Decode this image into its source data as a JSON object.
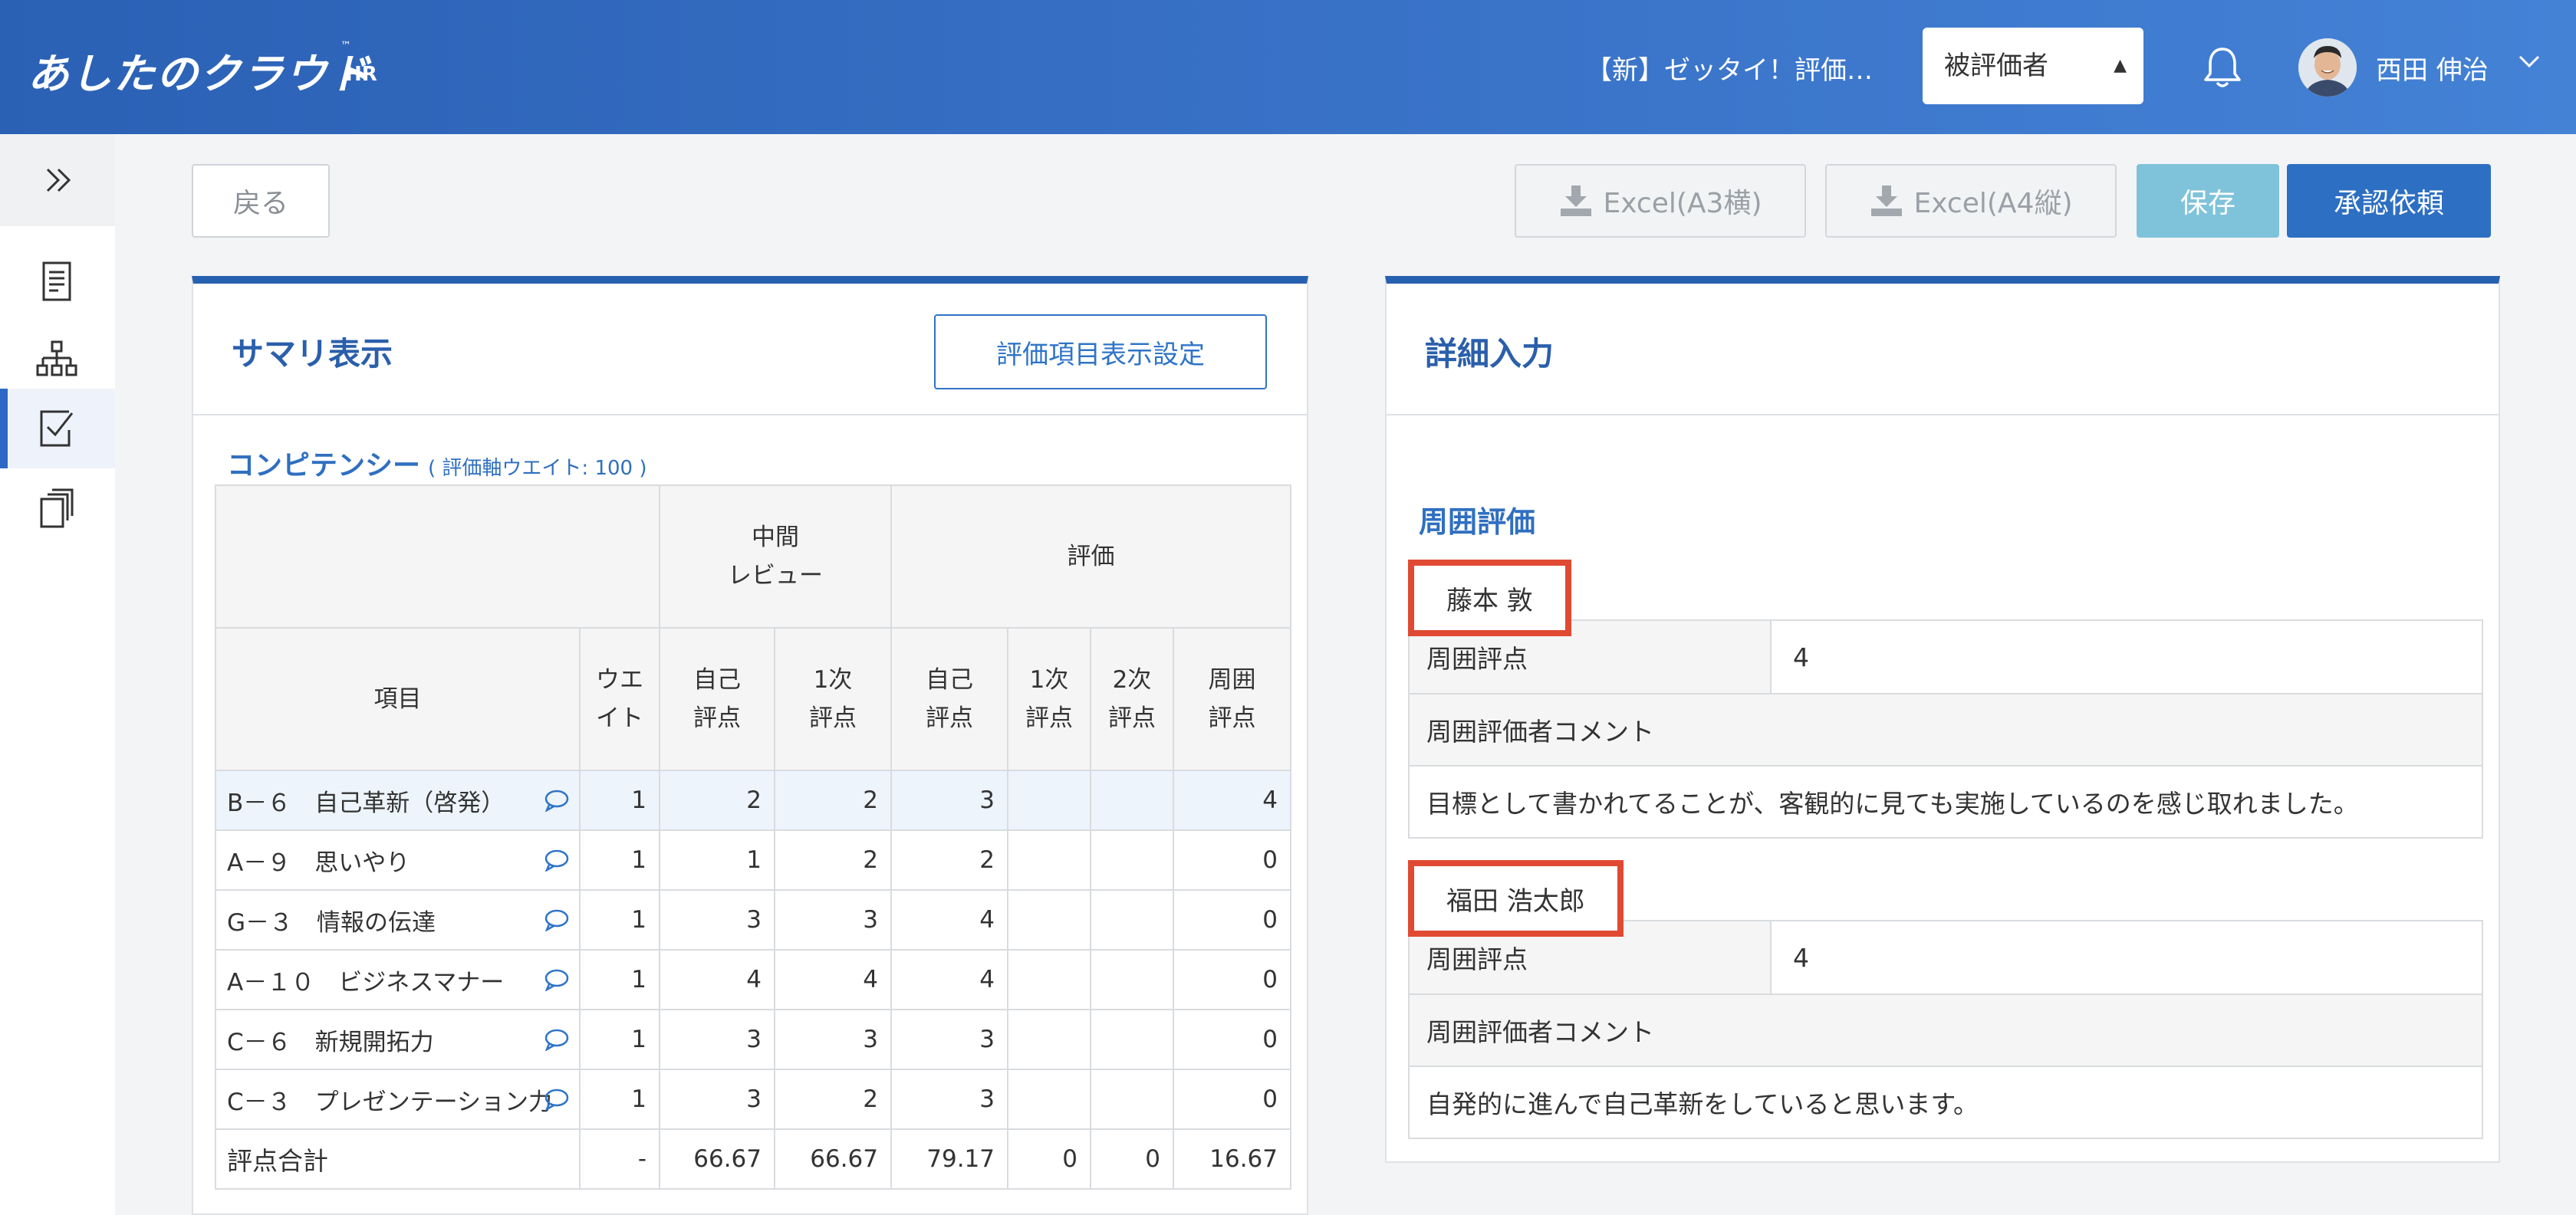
{
  "app": {
    "logo": "あしたのクラウド",
    "logo_tm": "™",
    "logo_sub": "HR",
    "doc_title": "【新】ゼッタイ！評価…",
    "role_select": {
      "selected": "被評価者"
    },
    "user_name": "西田 伸治"
  },
  "sidebar": {
    "items": [
      {
        "icon": "document-icon"
      },
      {
        "icon": "org-chart-icon"
      },
      {
        "icon": "checklist-icon",
        "active": true
      },
      {
        "icon": "copy-icon"
      }
    ]
  },
  "toolbar": {
    "back": "戻る",
    "excel_a3": "Excel(A3横)",
    "excel_a4": "Excel(A4縦)",
    "save": "保存",
    "approve": "承認依頼"
  },
  "summary": {
    "title": "サマリ表示",
    "settings_button": "評価項目表示設定",
    "section_title": "コンピテンシー",
    "section_sub": "( 評価軸ウエイト: 100 )",
    "group_headers": {
      "mid_review": "中間\nレビュー",
      "evaluation": "評価"
    },
    "columns": {
      "item": "項目",
      "weight": "ウエ\nイト",
      "mid_self": "自己\n評点",
      "mid_first": "1次\n評点",
      "self": "自己\n評点",
      "first": "1次\n評点",
      "second": "2次\n評点",
      "peer": "周囲\n評点"
    },
    "rows": [
      {
        "item": "B－６　自己革新（啓発）",
        "weight": "1",
        "mid_self": "2",
        "mid_first": "2",
        "self": "3",
        "first": "",
        "second": "",
        "peer": "4"
      },
      {
        "item": "A－９　思いやり",
        "weight": "1",
        "mid_self": "1",
        "mid_first": "2",
        "self": "2",
        "first": "",
        "second": "",
        "peer": "0"
      },
      {
        "item": "G－３　情報の伝達",
        "weight": "1",
        "mid_self": "3",
        "mid_first": "3",
        "self": "4",
        "first": "",
        "second": "",
        "peer": "0"
      },
      {
        "item": "A－１０　ビジネスマナー",
        "weight": "1",
        "mid_self": "4",
        "mid_first": "4",
        "self": "4",
        "first": "",
        "second": "",
        "peer": "0"
      },
      {
        "item": "C－６　新規開拓力",
        "weight": "1",
        "mid_self": "3",
        "mid_first": "3",
        "self": "3",
        "first": "",
        "second": "",
        "peer": "0"
      },
      {
        "item": "C－３　プレゼンテーション力",
        "weight": "1",
        "mid_self": "3",
        "mid_first": "2",
        "self": "3",
        "first": "",
        "second": "",
        "peer": "0"
      }
    ],
    "total": {
      "item": "評点合計",
      "weight": "-",
      "mid_self": "66.67",
      "mid_first": "66.67",
      "self": "79.17",
      "first": "0",
      "second": "0",
      "peer": "16.67"
    }
  },
  "detail": {
    "title": "詳細入力",
    "peer_title": "周囲評価",
    "evaluators": [
      {
        "name": "藤本 敦",
        "score_label": "周囲評点",
        "score": "4",
        "comment_label": "周囲評価者コメント",
        "comment": "目標として書かれてることが、客観的に見ても実施しているのを感じ取れました。"
      },
      {
        "name": "福田 浩太郎",
        "score_label": "周囲評点",
        "score": "4",
        "comment_label": "周囲評価者コメント",
        "comment": "自発的に進んで自己革新をしていると思います。"
      }
    ]
  },
  "colors": {
    "header": "#3a74c9",
    "accent": "#2d6fc2",
    "save_disabled": "#7fc3da",
    "highlight_box": "#e04a33",
    "selected_row": "#edf4fb"
  }
}
